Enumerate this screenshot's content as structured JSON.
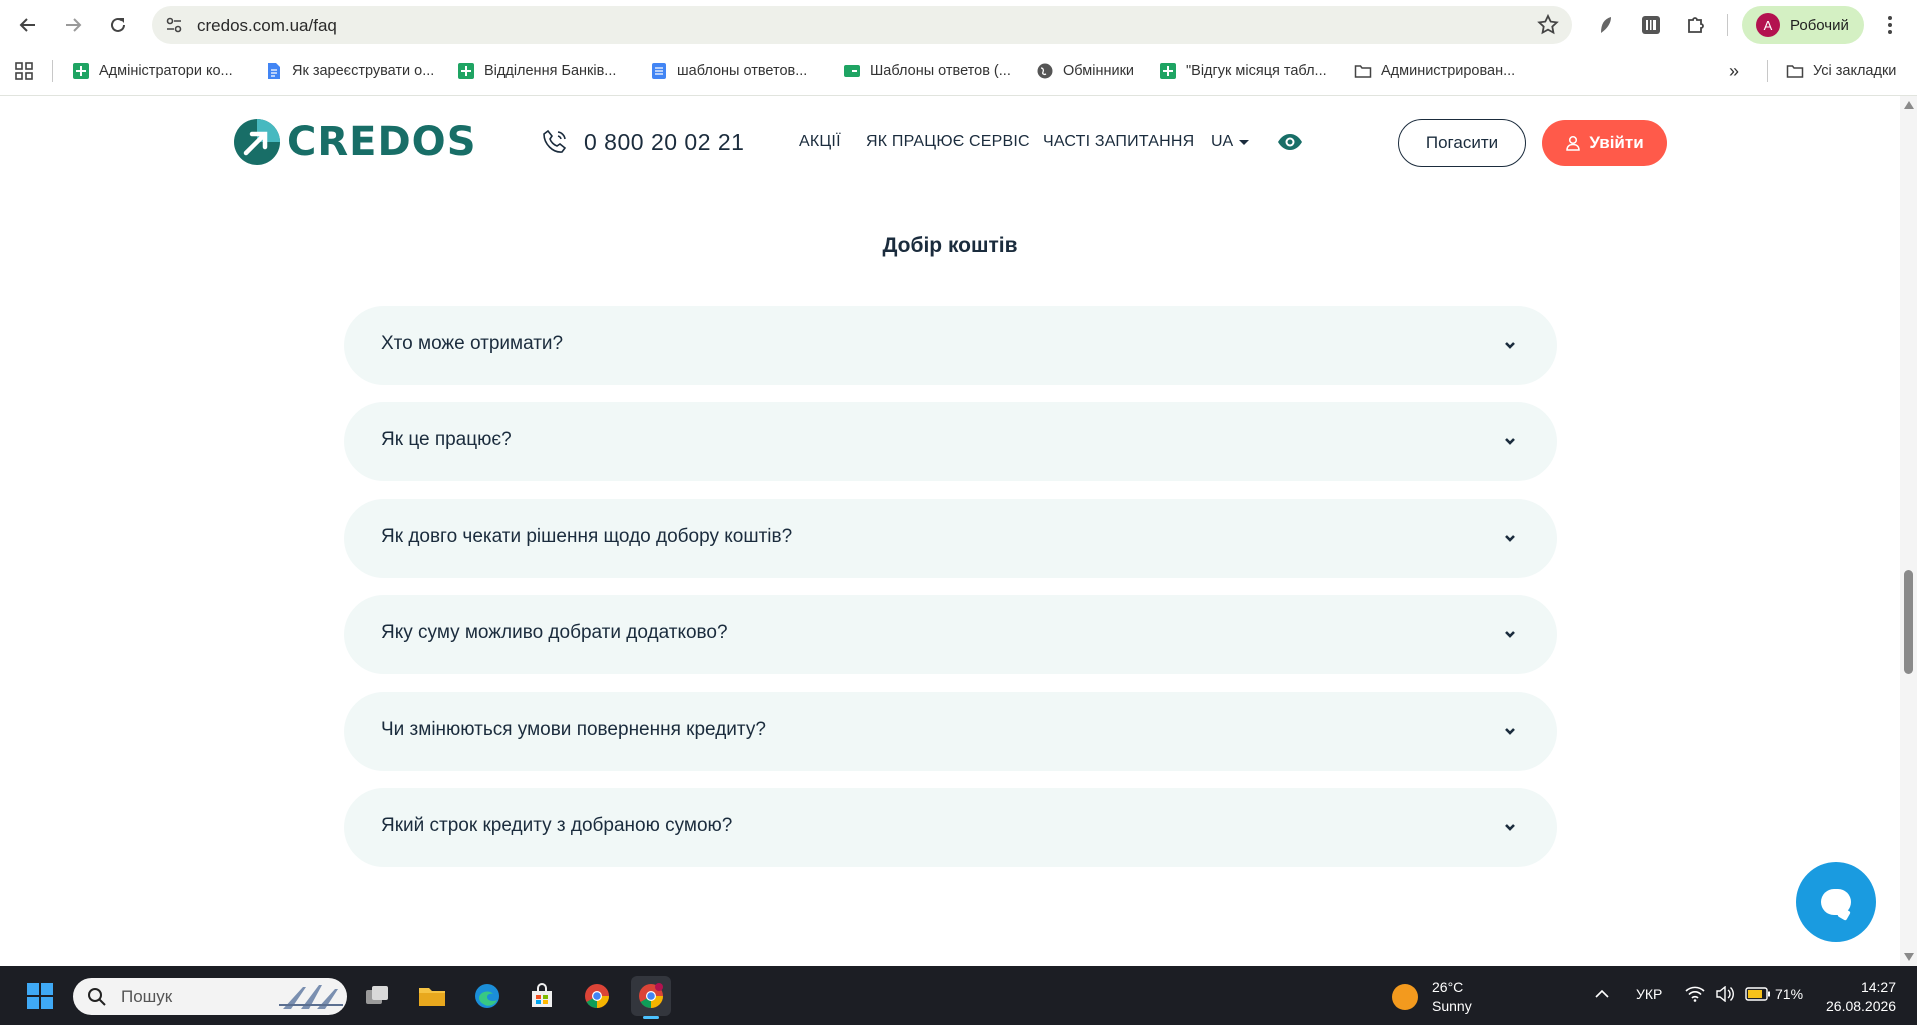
{
  "browser": {
    "url": "credos.com.ua/faq",
    "profile_initial": "A",
    "profile_name": "Робочий",
    "bookmarks": [
      "Адміністратори ко...",
      "Як зареєструвати о...",
      "Відділення Банків...",
      "шаблоны ответов...",
      "Шаблоны ответов (...",
      "Обмінники",
      "\"Відгук місяця табл...",
      "Администрирован..."
    ],
    "all_bookmarks": "Усі закладки",
    "overflow": "»"
  },
  "site": {
    "logo": "CREDOS",
    "phone": "0 800 20 02 21",
    "nav": [
      "АКЦІЇ",
      "ЯК ПРАЦЮЄ СЕРВІС",
      "ЧАСТІ ЗАПИТАННЯ"
    ],
    "lang": "UA",
    "repay_label": "Погасити",
    "login_label": "Увійти",
    "section_title": "Добір коштів",
    "faq": [
      "Хто може отримати?",
      "Як це працює?",
      "Як довго чекати рішення щодо добору коштів?",
      "Яку суму можливо добрати додатково?",
      "Чи змінюються умови повернення кредиту?",
      "Який строк кредиту з добраною сумою?"
    ],
    "accent": "#ff5a4a",
    "brand": "#186e67"
  },
  "taskbar": {
    "search_placeholder": "Пошук",
    "temp": "26°C",
    "weather": "Sunny",
    "lang": "УКР",
    "battery": "71%",
    "time": "14:27",
    "date": "26.08.2026"
  }
}
